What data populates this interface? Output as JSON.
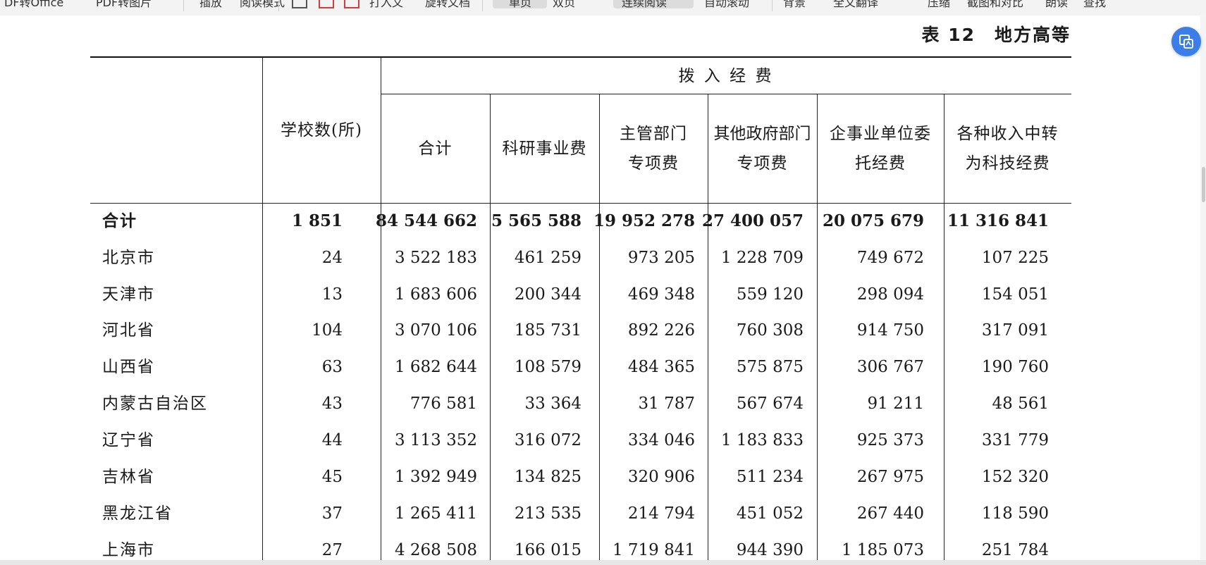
{
  "toolbar": {
    "items": [
      "DF转Office",
      "PDF转图片",
      "插放",
      "阅读模式",
      "打入文",
      "旋转文档",
      "单页",
      "双页",
      "连续阅读",
      "自动滚动",
      "背景",
      "全文翻译",
      "压缩",
      "截图和对比",
      "朗读",
      "查找"
    ]
  },
  "table": {
    "title": "表 12　地方高等",
    "headers": {
      "schools": "学校数(所)",
      "funding_group": "拨 入 经 费",
      "total": "合计",
      "research": "科研事业费",
      "dept_line1": "主管部门",
      "dept_line2": "专项费",
      "other_gov_line1": "其他政府部门",
      "other_gov_line2": "专项费",
      "enterprise_line1": "企事业单位委",
      "enterprise_line2": "托经费",
      "income_line1": "各种收入中转",
      "income_line2": "为科技经费"
    },
    "rows": [
      {
        "region": "合计",
        "schools": "1 851",
        "total": "84 544 662",
        "research": "5 565 588",
        "dept": "19 952 278",
        "other_gov": "27 400 057",
        "enterprise": "20 075 679",
        "income": "11 316 841"
      },
      {
        "region": "北京市",
        "schools": "24",
        "total": "3 522 183",
        "research": "461 259",
        "dept": "973 205",
        "other_gov": "1 228 709",
        "enterprise": "749 672",
        "income": "107 225"
      },
      {
        "region": "天津市",
        "schools": "13",
        "total": "1 683 606",
        "research": "200 344",
        "dept": "469 348",
        "other_gov": "559 120",
        "enterprise": "298 094",
        "income": "154 051"
      },
      {
        "region": "河北省",
        "schools": "104",
        "total": "3 070 106",
        "research": "185 731",
        "dept": "892 226",
        "other_gov": "760 308",
        "enterprise": "914 750",
        "income": "317 091"
      },
      {
        "region": "山西省",
        "schools": "63",
        "total": "1 682 644",
        "research": "108 579",
        "dept": "484 365",
        "other_gov": "575 875",
        "enterprise": "306 767",
        "income": "190 760"
      },
      {
        "region": "内蒙古自治区",
        "schools": "43",
        "total": "776 581",
        "research": "33 364",
        "dept": "31 787",
        "other_gov": "567 674",
        "enterprise": "91 211",
        "income": "48 561"
      },
      {
        "region": "辽宁省",
        "schools": "44",
        "total": "3 113 352",
        "research": "316 072",
        "dept": "334 046",
        "other_gov": "1 183 833",
        "enterprise": "925 373",
        "income": "331 779"
      },
      {
        "region": "吉林省",
        "schools": "45",
        "total": "1 392 949",
        "research": "134 825",
        "dept": "320 906",
        "other_gov": "511 234",
        "enterprise": "267 975",
        "income": "152 320"
      },
      {
        "region": "黑龙江省",
        "schools": "37",
        "total": "1 265 411",
        "research": "213 535",
        "dept": "214 794",
        "other_gov": "451 052",
        "enterprise": "267 440",
        "income": "118 590"
      },
      {
        "region": "上海市",
        "schools": "27",
        "total": "4 268 508",
        "research": "166 015",
        "dept": "1 719 841",
        "other_gov": "944 390",
        "enterprise": "1 185 073",
        "income": "251 784"
      }
    ]
  }
}
